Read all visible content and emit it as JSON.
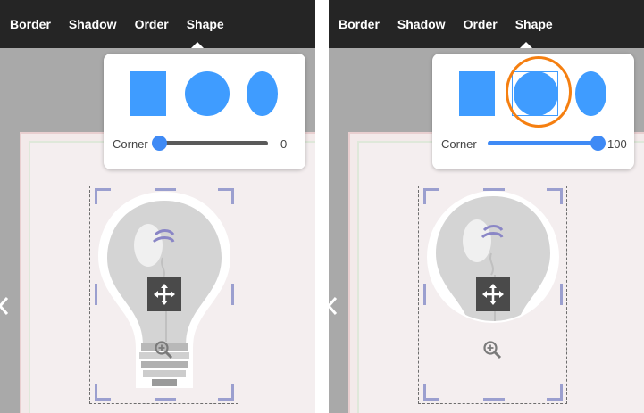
{
  "toolbar": {
    "items": [
      "Border",
      "Shadow",
      "Order",
      "Shape"
    ]
  },
  "shape_popover": {
    "corner_label": "Corner",
    "shapes": [
      "square-icon",
      "circle-icon",
      "ellipse-icon"
    ]
  },
  "panels": [
    {
      "selected_shape": "square",
      "corner_value": "0",
      "corner_fraction": 0.0
    },
    {
      "selected_shape": "circle",
      "corner_value": "100",
      "corner_fraction": 1.0
    }
  ],
  "icons": {
    "move": "move-icon",
    "zoom": "zoom-in-icon",
    "nav": "chevron-left-icon",
    "image": "lightbulb-icon"
  },
  "colors": {
    "toolbar_bg": "#252525",
    "shape_fill": "#3f9cff",
    "slider_accent": "#3f8af5",
    "highlight_ring": "#f57f10",
    "handle": "#9b9fcf"
  }
}
